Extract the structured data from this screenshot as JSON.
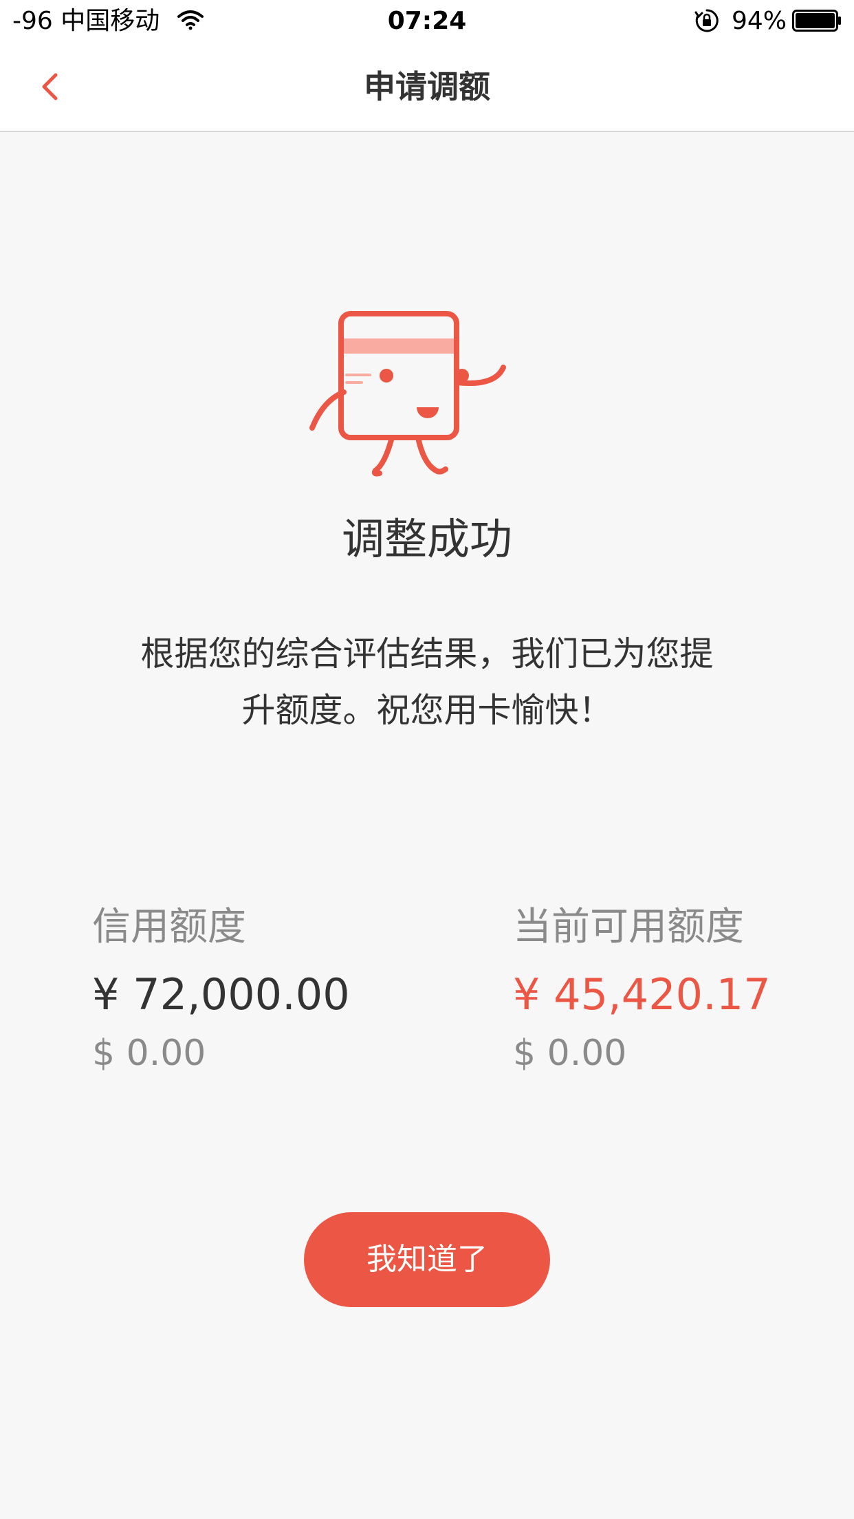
{
  "status_bar": {
    "carrier": "-96 中国移动",
    "time": "07:24",
    "battery_percent": "94%",
    "icons": [
      "wifi-icon",
      "orientation-lock-icon",
      "battery-icon"
    ]
  },
  "nav": {
    "title": "申请调额",
    "back_icon": "chevron-left-icon"
  },
  "colors": {
    "accent": "#ec5745",
    "accent_light": "#f9aba1",
    "background": "#f7f7f7",
    "text_primary": "#333333",
    "text_secondary": "#8a8a8a"
  },
  "result": {
    "mascot_icon": "credit-card-mascot-icon",
    "title": "调整成功",
    "message_line1": "根据您的综合评估结果，我们已为您提",
    "message_line2": "升额度。祝您用卡愉快！"
  },
  "limits": {
    "credit": {
      "label": "信用额度",
      "cny": "¥ 72,000.00",
      "usd": "$ 0.00"
    },
    "available": {
      "label": "当前可用额度",
      "cny": "¥ 45,420.17",
      "usd": "$ 0.00"
    }
  },
  "actions": {
    "confirm_label": "我知道了"
  }
}
